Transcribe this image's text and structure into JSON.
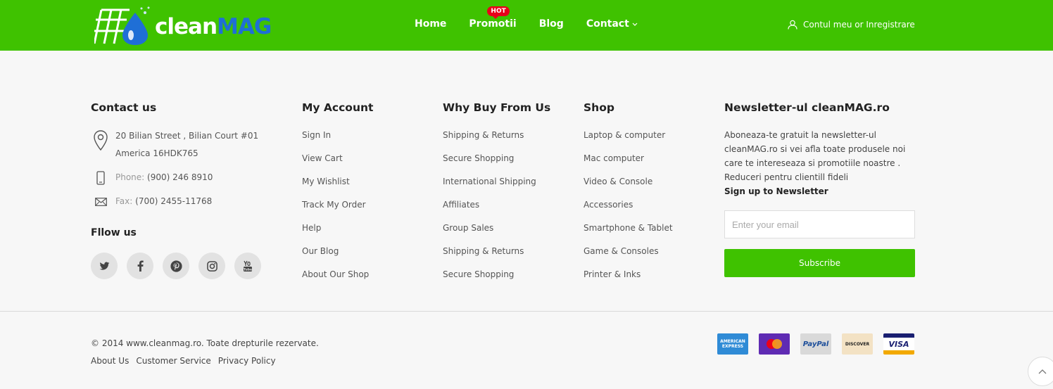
{
  "header": {
    "logo": {
      "word_white": "clean",
      "word_blue": "MAG"
    },
    "nav": [
      {
        "label": "Home"
      },
      {
        "label": "Promotii",
        "badge": "HOT"
      },
      {
        "label": "Blog"
      },
      {
        "label": "Contact",
        "icon": "chevron-down-icon"
      }
    ],
    "account_label": "Contul meu or Inregistrare"
  },
  "contact": {
    "title": "Contact us",
    "address": "20 Bilian Street , Bilian Court #01 America 16HDK765",
    "phone_label": "Phone:",
    "phone": "(900) 246 8910",
    "fax_label": "Fax:",
    "fax": "(700) 2455-11768",
    "follow_title": "Fllow us",
    "socials": [
      "twitter-icon",
      "facebook-icon",
      "pinterest-icon",
      "instagram-icon",
      "youtube-icon"
    ]
  },
  "my_account": {
    "title": "My Account",
    "links": [
      "Sign In",
      "View Cart",
      "My Wishlist",
      "Track My Order",
      "Help",
      "Our Blog",
      "About Our Shop"
    ]
  },
  "why_buy": {
    "title": "Why Buy From Us",
    "links": [
      "Shipping & Returns",
      "Secure Shopping",
      "International Shipping",
      "Affiliates",
      "Group Sales",
      "Shipping & Returns",
      "Secure Shopping"
    ]
  },
  "shop": {
    "title": "Shop",
    "links": [
      "Laptop & computer",
      "Mac computer",
      "Video & Console",
      "Accessories",
      "Smartphone & Tablet",
      "Game & Consoles",
      "Printer & Inks"
    ]
  },
  "newsletter": {
    "title": "Newsletter-ul cleanMAG.ro",
    "text": "Aboneaza-te gratuit la newsletter-ul cleanMAG.ro si vei afla toate produsele noi care te intereseaza si promotiile noastre . Reduceri pentru clientill fideli",
    "signup": "Sign up to Newsletter",
    "placeholder": "Enter your email",
    "button": "Subscribe"
  },
  "bottom": {
    "copyright": "© 2014 www.cleanmag.ro. Toate drepturile rezervate.",
    "links": [
      "About Us",
      "Customer Service",
      "Privacy Policy"
    ],
    "payments": {
      "amex_line1": "AMERICAN",
      "amex_line2": "EXPRESS",
      "paypal": "PayPal",
      "discover": "DISCOVER",
      "visa": "VISA"
    }
  },
  "colors": {
    "brand_green": "#3fc200",
    "hot_red": "#e8001a",
    "logo_blue": "#1f6fd6"
  }
}
